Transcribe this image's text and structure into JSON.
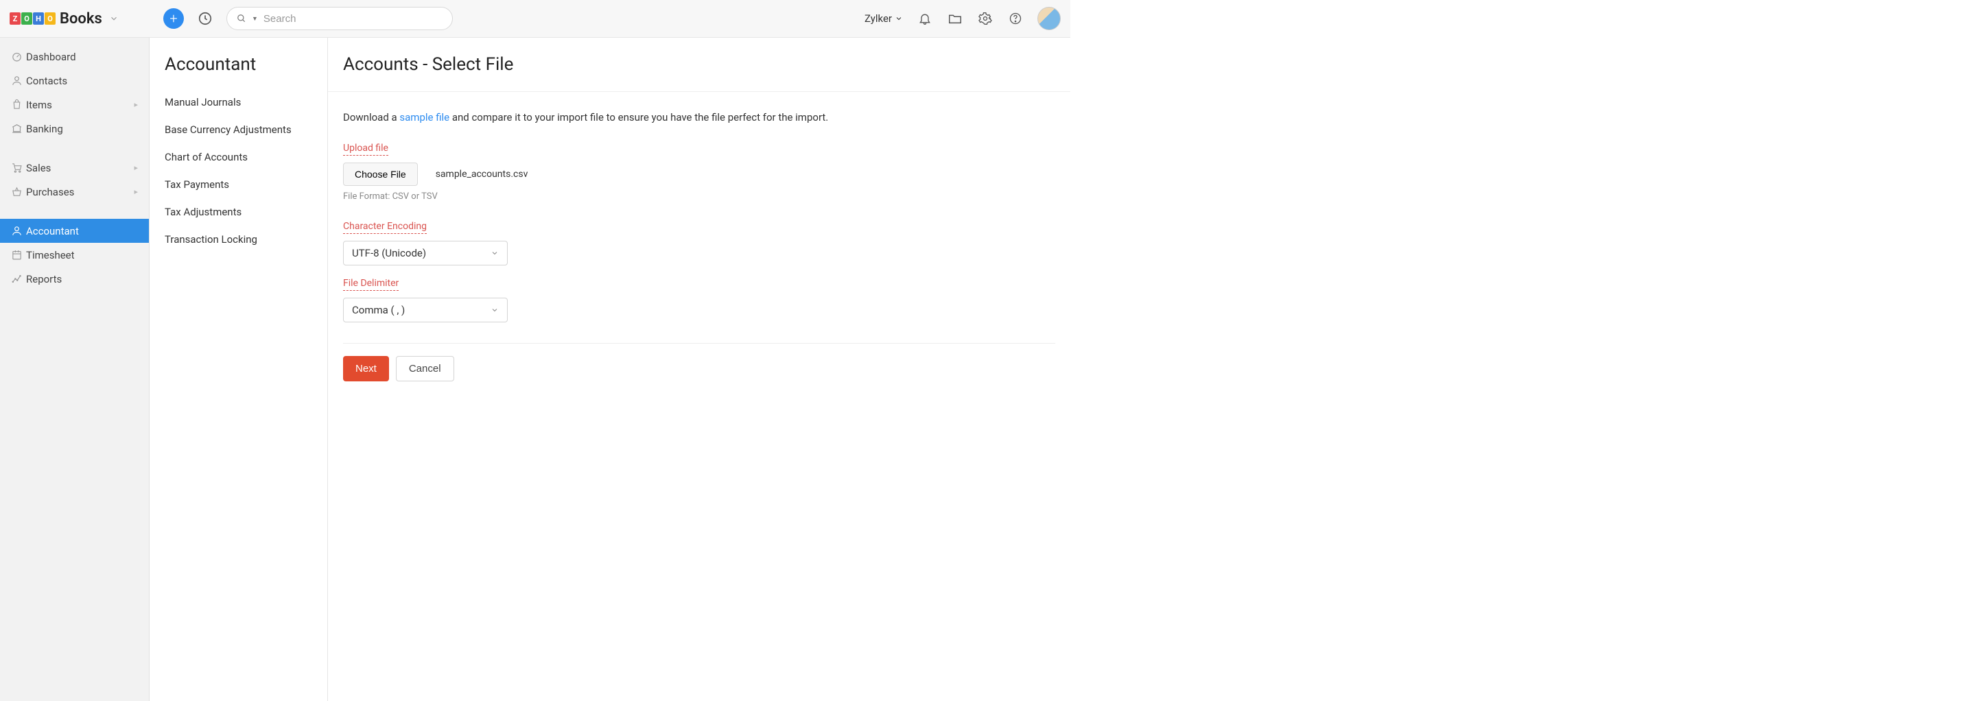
{
  "brand": {
    "name": "Books"
  },
  "topbar": {
    "search_placeholder": "Search",
    "org_name": "Zylker"
  },
  "leftnav": {
    "items": [
      {
        "id": "dashboard",
        "label": "Dashboard",
        "icon": "gauge",
        "expandable": false
      },
      {
        "id": "contacts",
        "label": "Contacts",
        "icon": "user",
        "expandable": false
      },
      {
        "id": "items",
        "label": "Items",
        "icon": "bag",
        "expandable": true
      },
      {
        "id": "banking",
        "label": "Banking",
        "icon": "bank",
        "expandable": false
      }
    ],
    "items2": [
      {
        "id": "sales",
        "label": "Sales",
        "icon": "cart",
        "expandable": true
      },
      {
        "id": "purchases",
        "label": "Purchases",
        "icon": "basket",
        "expandable": true
      }
    ],
    "items3": [
      {
        "id": "accountant",
        "label": "Accountant",
        "icon": "person",
        "expandable": false,
        "active": true
      },
      {
        "id": "timesheet",
        "label": "Timesheet",
        "icon": "calendar",
        "expandable": false
      },
      {
        "id": "reports",
        "label": "Reports",
        "icon": "chart",
        "expandable": false
      }
    ]
  },
  "subnav": {
    "title": "Accountant",
    "items": [
      {
        "label": "Manual Journals"
      },
      {
        "label": "Base Currency Adjustments"
      },
      {
        "label": "Chart of Accounts"
      },
      {
        "label": "Tax Payments"
      },
      {
        "label": "Tax Adjustments"
      },
      {
        "label": "Transaction Locking"
      }
    ]
  },
  "main": {
    "title": "Accounts - Select File",
    "instruction_prefix": "Download a ",
    "instruction_link": "sample file",
    "instruction_suffix": " and compare it to your import file to ensure you have the file perfect for the import.",
    "upload": {
      "label": "Upload file",
      "button": "Choose File",
      "filename": "sample_accounts.csv",
      "hint": "File Format: CSV or TSV"
    },
    "encoding": {
      "label": "Character Encoding",
      "value": "UTF-8 (Unicode)"
    },
    "delimiter": {
      "label": "File Delimiter",
      "value": "Comma ( , )"
    },
    "actions": {
      "next": "Next",
      "cancel": "Cancel"
    }
  }
}
